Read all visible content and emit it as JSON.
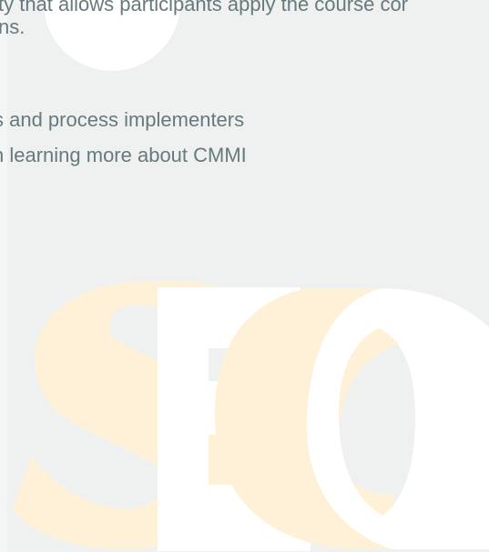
{
  "document": {
    "intro_lines": [
      "ty that allows participants apply the course cor",
      "ns."
    ],
    "bullets": [
      "s and process implementers",
      "n learning more about CMMI"
    ]
  },
  "watermark": {
    "logo_text": "SEC",
    "colors": {
      "s": "#fff1d7",
      "e": "#ffffff",
      "c_orange": "#fff1d7",
      "c_white": "#ffffff"
    }
  },
  "theme": {
    "background": "#eef1f0",
    "text": "#68797e",
    "circle": "#ffffff"
  }
}
